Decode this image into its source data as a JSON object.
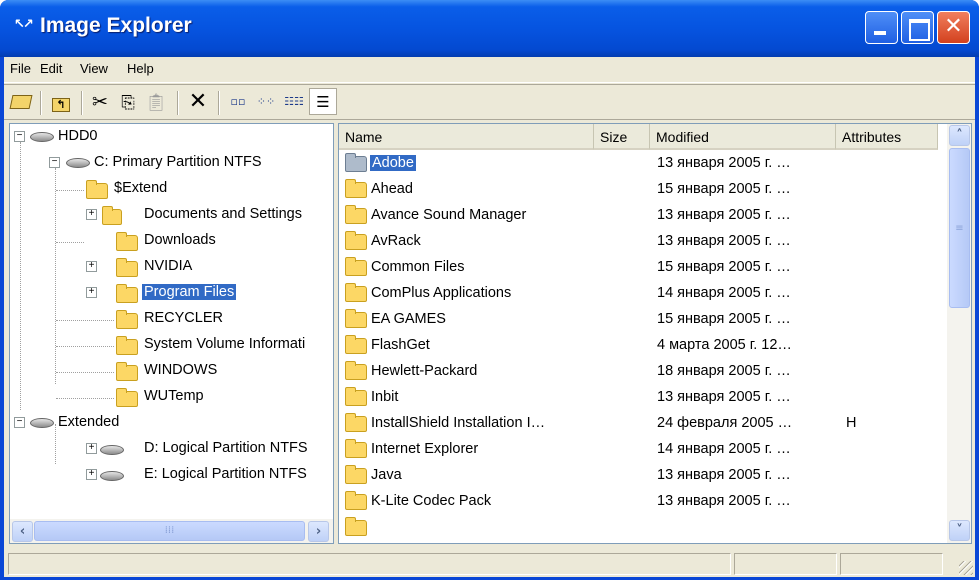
{
  "window": {
    "title": "Image Explorer"
  },
  "menu": [
    {
      "label": "File"
    },
    {
      "label": "Edit"
    },
    {
      "label": "View"
    },
    {
      "label": "Help"
    }
  ],
  "toolbar": {
    "buttons": [
      "open-folder-icon",
      "up-folder-icon",
      "cut-icon",
      "copy-icon",
      "paste-icon",
      "delete-icon",
      "large-icons-view-icon",
      "small-icons-view-icon",
      "list-view-icon",
      "details-view-icon"
    ],
    "active": "details-view-icon"
  },
  "tree": {
    "root": "HDD0",
    "primary": "C: Primary Partition NTFS",
    "folders": [
      "$Extend",
      "Documents and Settings",
      "Downloads",
      "NVIDIA",
      "Program Files",
      "RECYCLER",
      "System Volume Informati",
      "WINDOWS",
      "WUTemp"
    ],
    "extended": "Extended",
    "logical": [
      "D: Logical Partition NTFS",
      "E: Logical Partition NTFS"
    ],
    "selected": "Program Files"
  },
  "list": {
    "columns": {
      "name": "Name",
      "size": "Size",
      "modified": "Modified",
      "attributes": "Attributes"
    },
    "rows": [
      {
        "name": "Adobe",
        "modified": "13 января 2005 г. …",
        "attributes": ""
      },
      {
        "name": "Ahead",
        "modified": "15 января 2005 г. …",
        "attributes": ""
      },
      {
        "name": "Avance Sound Manager",
        "modified": "13 января 2005 г. …",
        "attributes": ""
      },
      {
        "name": "AvRack",
        "modified": "13 января 2005 г. …",
        "attributes": ""
      },
      {
        "name": "Common Files",
        "modified": "15 января 2005 г. …",
        "attributes": ""
      },
      {
        "name": "ComPlus Applications",
        "modified": "14 января 2005 г. …",
        "attributes": ""
      },
      {
        "name": "EA GAMES",
        "modified": "15 января 2005 г. …",
        "attributes": ""
      },
      {
        "name": "FlashGet",
        "modified": "4 марта 2005 г. 12…",
        "attributes": ""
      },
      {
        "name": "Hewlett-Packard",
        "modified": "18 января 2005 г. …",
        "attributes": ""
      },
      {
        "name": "Inbit",
        "modified": "13 января 2005 г. …",
        "attributes": ""
      },
      {
        "name": "InstallShield Installation I…",
        "modified": "24 февраля 2005 …",
        "attributes": "H"
      },
      {
        "name": "Internet Explorer",
        "modified": "14 января 2005 г. …",
        "attributes": ""
      },
      {
        "name": "Java",
        "modified": "13 января 2005 г. …",
        "attributes": ""
      },
      {
        "name": "K-Lite Codec Pack",
        "modified": "13 января 2005 г. …",
        "attributes": ""
      }
    ],
    "selected": "Adobe"
  },
  "colors": {
    "titlebar": "#0654e0",
    "selection": "#316ac5",
    "face": "#ece9d8",
    "folder": "#fcd765"
  }
}
